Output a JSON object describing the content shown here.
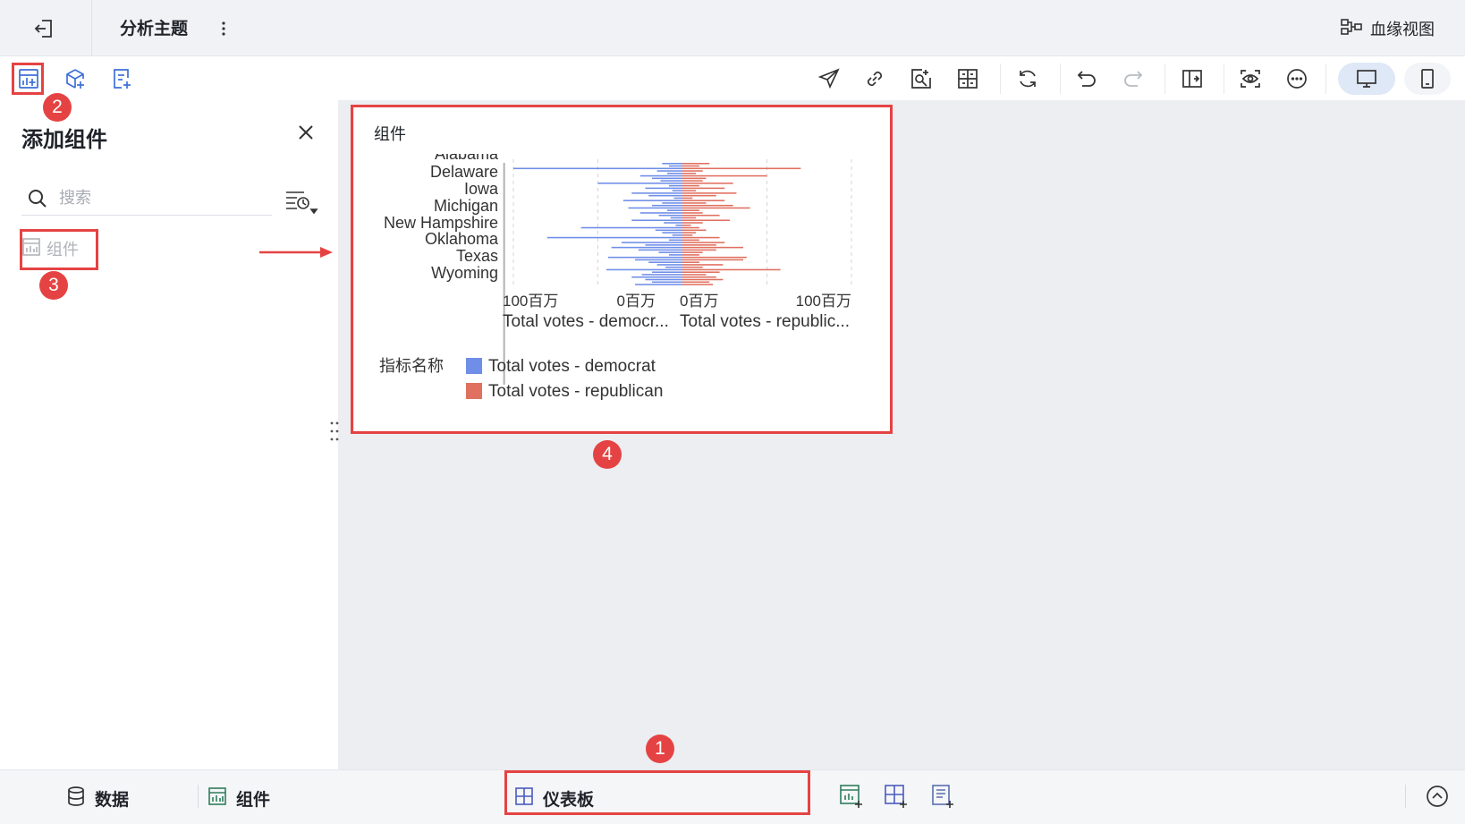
{
  "header": {
    "title": "分析主题",
    "lineage_label": "血缘视图"
  },
  "toolbar": {
    "left_icons": [
      "add-widget-icon",
      "add-model-icon",
      "add-report-icon"
    ],
    "right_icons": [
      "send-icon",
      "link-icon",
      "image-search-icon",
      "grid-layout-icon",
      "refresh-icon",
      "undo-icon",
      "redo-icon",
      "split-view-icon",
      "preview-eye-icon",
      "more-circle-icon"
    ],
    "device_modes": [
      "desktop",
      "mobile"
    ],
    "active_device": "desktop"
  },
  "panel": {
    "title": "添加组件",
    "search_placeholder": "搜索",
    "items": [
      {
        "label": "组件",
        "icon": "chart-icon"
      }
    ]
  },
  "widget": {
    "title": "组件",
    "legend_title": "指标名称",
    "legend": [
      {
        "label": "Total votes - democrat",
        "color": "#6f8ee8"
      },
      {
        "label": "Total votes - republican",
        "color": "#e07060"
      }
    ]
  },
  "chart_data": {
    "type": "bar",
    "orientation": "horizontal-butterfly",
    "y_tick_labels": [
      "Alabama",
      "Delaware",
      "Iowa",
      "Michigan",
      "New Hampshire",
      "Oklahoma",
      "Texas",
      "Wyoming"
    ],
    "left_axis": {
      "ticks": [
        "100百万",
        "0百万"
      ],
      "label": "Total votes - democr..."
    },
    "right_axis": {
      "ticks": [
        "0百万",
        "100百万"
      ],
      "label": "Total votes - republic..."
    },
    "unit": "百万",
    "series": [
      {
        "name": "Total votes - democrat",
        "color": "#6f8ee8",
        "values": [
          12,
          8,
          100,
          15,
          9,
          25,
          18,
          13,
          50,
          8,
          22,
          6,
          30,
          20,
          5,
          35,
          12,
          18,
          32,
          9,
          25,
          14,
          7,
          30,
          11,
          4,
          60,
          16,
          12,
          6,
          80,
          8,
          36,
          22,
          42,
          26,
          14,
          8,
          44,
          28,
          20,
          15,
          10,
          45,
          18,
          24,
          30,
          22,
          18,
          28
        ]
      },
      {
        "name": "Total votes - republican",
        "color": "#e07060",
        "values": [
          16,
          10,
          70,
          12,
          8,
          50,
          14,
          12,
          30,
          10,
          25,
          8,
          32,
          20,
          6,
          25,
          14,
          30,
          40,
          10,
          12,
          22,
          8,
          28,
          12,
          5,
          10,
          14,
          8,
          6,
          22,
          10,
          25,
          20,
          36,
          20,
          12,
          10,
          38,
          36,
          10,
          24,
          12,
          58,
          22,
          14,
          20,
          24,
          16,
          18
        ]
      }
    ]
  },
  "bottom": {
    "tab_data": "数据",
    "tab_widget": "组件",
    "tab_dashboard": "仪表板",
    "action_icons": [
      "add-chart-icon",
      "add-dashboard-icon",
      "add-report-icon"
    ]
  },
  "annotations": [
    "1",
    "2",
    "3",
    "4"
  ]
}
